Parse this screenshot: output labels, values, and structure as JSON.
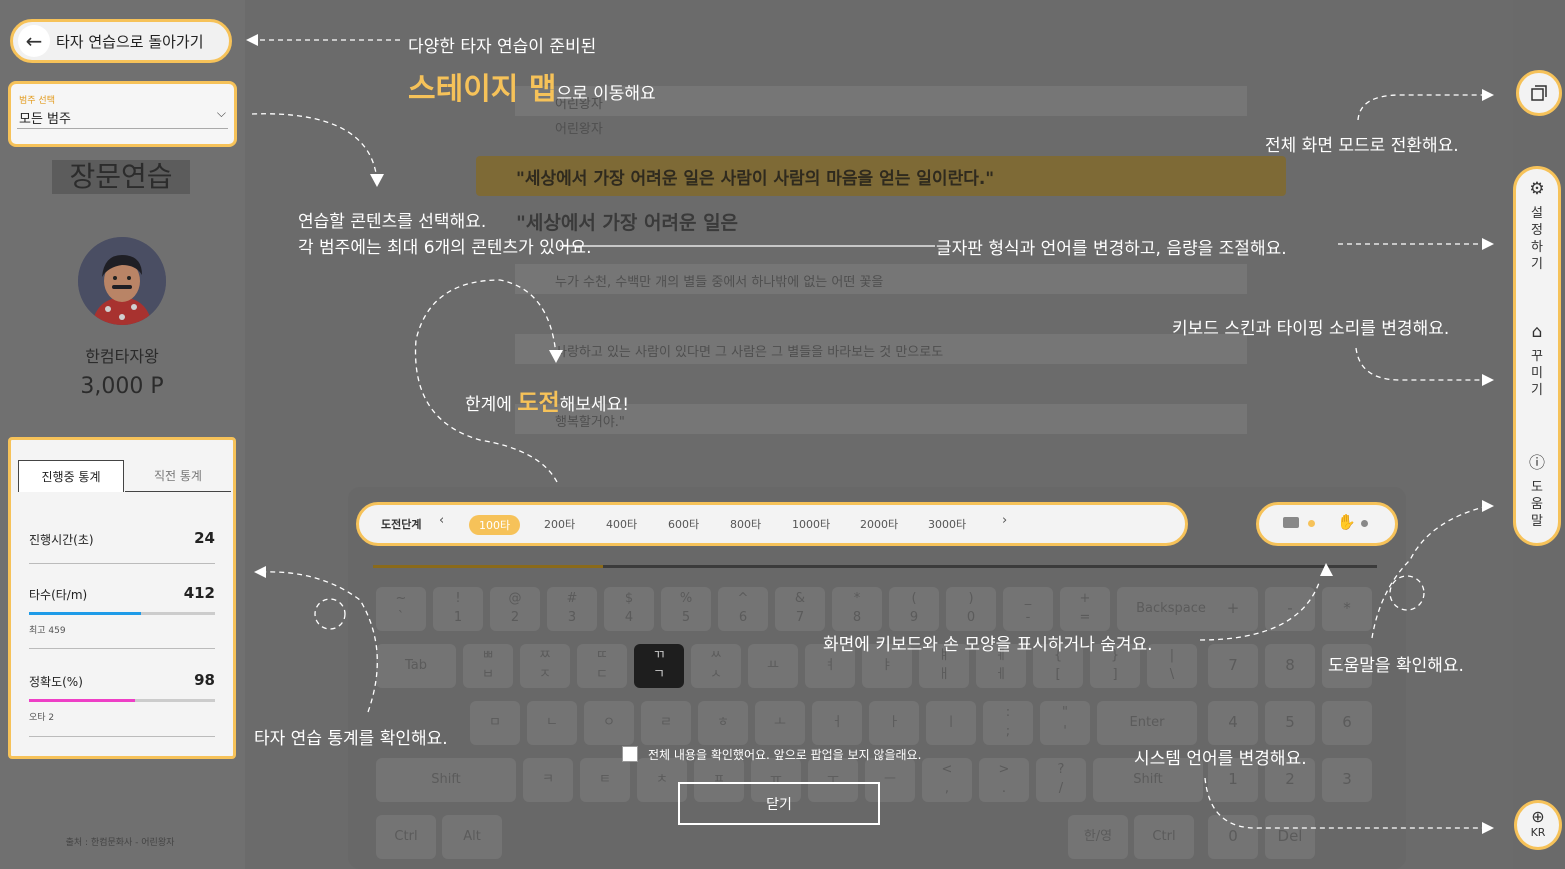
{
  "sidebar": {
    "back_label": "타자 연습으로 돌아가기",
    "category": {
      "label": "범주 선택",
      "value": "모든 범주"
    },
    "page_title": "장문연습",
    "user_name": "한컴타자왕",
    "points": "3,000 P",
    "stats": {
      "tabs": [
        "진행중 통계",
        "직전 통계"
      ],
      "items": [
        {
          "label": "진행시간(초)",
          "value": "24"
        },
        {
          "label": "타수(타/m)",
          "value": "412",
          "sub": "최고 459",
          "progress": 0.6,
          "color": "#1e9be8"
        },
        {
          "label": "정확도(%)",
          "value": "98",
          "sub": "오타 2",
          "progress": 0.57,
          "color": "#ee3fc6"
        }
      ]
    },
    "source": "출처 : 한컴문화사 - 어린왕자"
  },
  "main": {
    "strips": [
      "어린왕자",
      "어린왕자",
      "누가 수천, 수백만 개의 별들 중에서 하나밖에 없는 어떤 꽃을",
      "사랑하고 있는 사람이 있다면 그 사람은 그 별들을 바라보는 것 만으로도",
      "행복할거야.\""
    ],
    "quote": "\"세상에서 가장 어려운 일은 사람이 사람의 마음을 얻는 일이란다.\"",
    "typing": "\"세상에서 가장 어려운 일은",
    "levels": {
      "label": "도전단계",
      "items": [
        "100타",
        "200타",
        "400타",
        "600타",
        "800타",
        "1000타",
        "2000타",
        "3000타"
      ],
      "active": "100타"
    },
    "dialog": {
      "checkbox_label": "전체 내용을 확인했어요. 앞으로 팝업을 보지 않을래요.",
      "close_label": "닫기"
    }
  },
  "keyboard": {
    "row1": [
      "~\n`",
      "!\n1",
      "@\n2",
      "#\n3",
      "$\n4",
      "%\n5",
      "^\n6",
      "&\n7",
      "*\n8",
      "(\n9",
      ")\n0",
      "_\n-",
      "+\n=",
      "Backspace"
    ],
    "row2": [
      "Tab",
      "ㅃ\nㅂ",
      "ㅉ\nㅈ",
      "ㄸ\nㄷ",
      "ㄲ\nㄱ",
      "ㅆ\nㅅ",
      "ㅛ",
      "ㅕ",
      "ㅑ",
      "ㅒ\nㅐ",
      "ㅖ\nㅔ",
      "{\n[",
      "}\n]",
      "|\n\\"
    ],
    "row3": [
      "ㅁ",
      "ㄴ",
      "ㅇ",
      "ㄹ",
      "ㅎ",
      "ㅗ",
      "ㅓ",
      "ㅏ",
      "ㅣ",
      ":\n;",
      "\"\n'",
      "Enter"
    ],
    "row4": [
      "Shift",
      "ㅋ",
      "ㅌ",
      "ㅊ",
      "ㅍ",
      "ㅠ",
      "ㅜ",
      "ㅡ",
      "<\n,",
      ">\n.",
      "?\n/",
      "Shift"
    ],
    "row5": [
      "Ctrl",
      "Alt",
      "한/영",
      "Ctrl"
    ],
    "numpad": [
      "+",
      "-",
      "*",
      "7",
      "8",
      "9",
      "4",
      "5",
      "6",
      "1",
      "2",
      "3",
      "0",
      "Del"
    ]
  },
  "rightbar": {
    "settings": "설정하기",
    "decorate": "꾸미기",
    "help": "도움말",
    "language": "KR"
  },
  "annotations": {
    "back_1": "다양한 타자 연습이 준비된",
    "back_2_hl": "스테이지 맵",
    "back_2_rest": "으로 이동해요",
    "category_1": "연습할 콘텐츠를 선택해요.",
    "category_2": "각 범주에는 최대 6개의 콘텐츠가 있어요.",
    "challenge_pre": "한계에 ",
    "challenge_hl": "도전",
    "challenge_post": "해보세요!",
    "stats": "타자 연습 통계를 확인해요.",
    "fullscreen": "전체 화면 모드로 전환해요.",
    "settings": "글자판 형식과 언어를 변경하고, 음량을 조절해요.",
    "decorate": "키보드 스킨과 타이핑 소리를 변경해요.",
    "toggle": "화면에 키보드와 손 모양을 표시하거나 숨겨요.",
    "help": "도움말을 확인해요.",
    "language": "시스템 언어를 변경해요."
  }
}
